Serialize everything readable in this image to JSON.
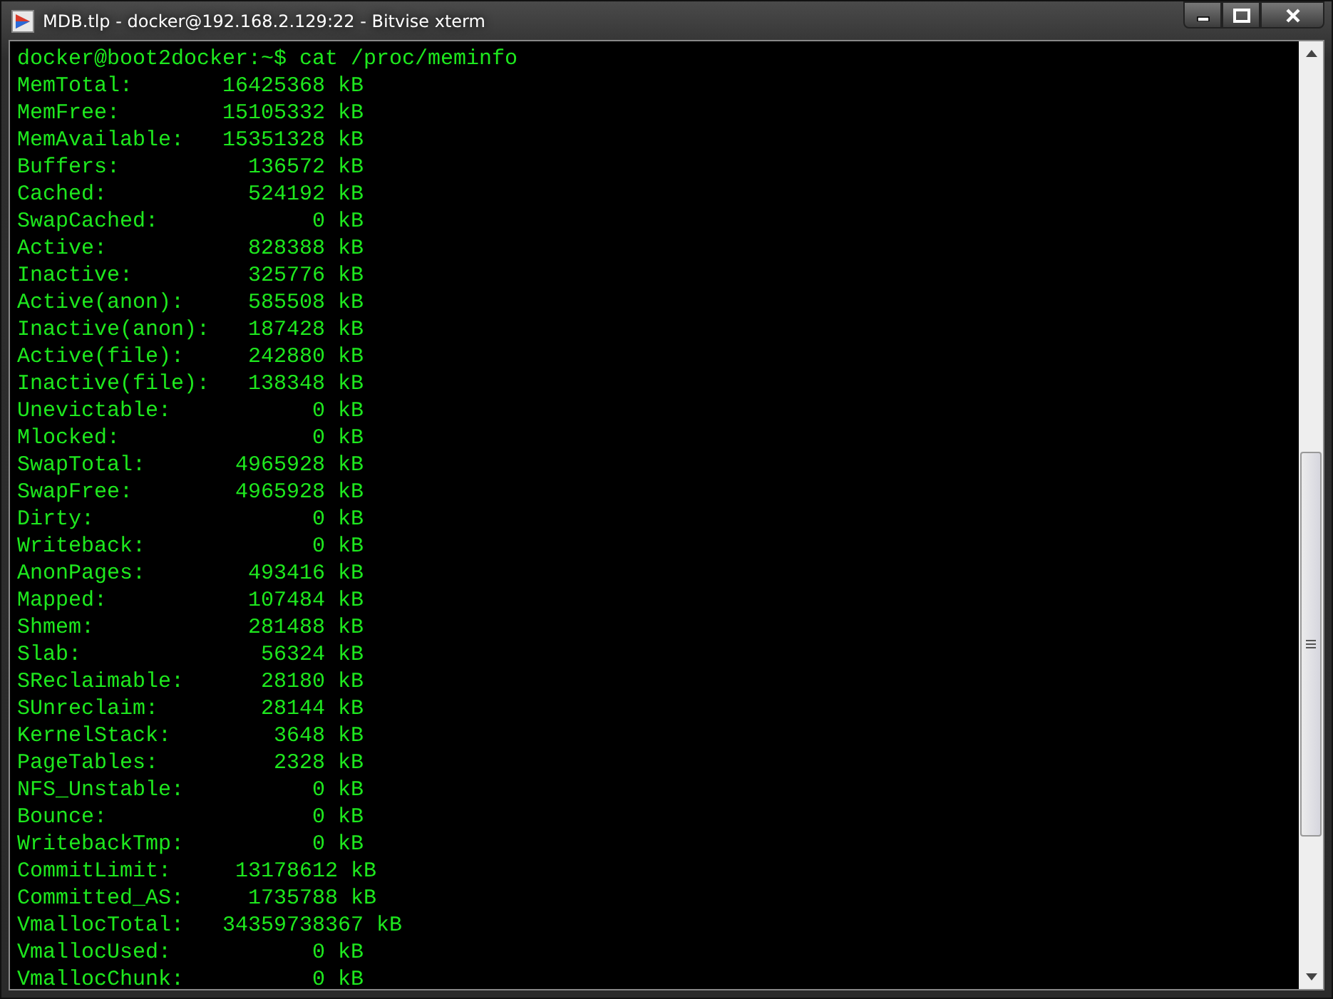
{
  "window": {
    "title": "MDB.tlp - docker@192.168.2.129:22 - Bitvise xterm"
  },
  "terminal": {
    "lines": [
      "docker@boot2docker:~$ cat /proc/meminfo",
      "MemTotal:       16425368 kB",
      "MemFree:        15105332 kB",
      "MemAvailable:   15351328 kB",
      "Buffers:          136572 kB",
      "Cached:           524192 kB",
      "SwapCached:            0 kB",
      "Active:           828388 kB",
      "Inactive:         325776 kB",
      "Active(anon):     585508 kB",
      "Inactive(anon):   187428 kB",
      "Active(file):     242880 kB",
      "Inactive(file):   138348 kB",
      "Unevictable:           0 kB",
      "Mlocked:               0 kB",
      "SwapTotal:       4965928 kB",
      "SwapFree:        4965928 kB",
      "Dirty:                 0 kB",
      "Writeback:             0 kB",
      "AnonPages:        493416 kB",
      "Mapped:           107484 kB",
      "Shmem:            281488 kB",
      "Slab:              56324 kB",
      "SReclaimable:      28180 kB",
      "SUnreclaim:        28144 kB",
      "KernelStack:        3648 kB",
      "PageTables:         2328 kB",
      "NFS_Unstable:          0 kB",
      "Bounce:                0 kB",
      "WritebackTmp:          0 kB",
      "CommitLimit:     13178612 kB",
      "Committed_AS:     1735788 kB",
      "VmallocTotal:   34359738367 kB",
      "VmallocUsed:           0 kB",
      "VmallocChunk:          0 kB"
    ]
  }
}
